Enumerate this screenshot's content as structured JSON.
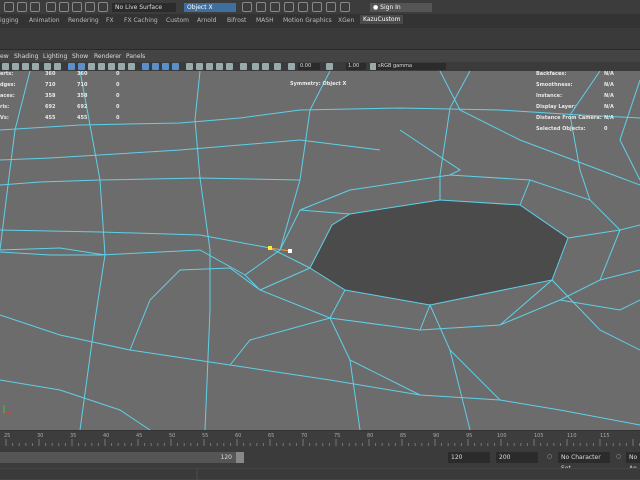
{
  "topbar": {
    "live_surface": "No Live Surface",
    "symmetry_field": "Object X",
    "signin": "Sign In"
  },
  "shelf_tabs": [
    "igging",
    "Animation",
    "Rendering",
    "FX",
    "FX Caching",
    "Custom",
    "Arnold",
    "Bifrost",
    "MASH",
    "Motion Graphics",
    "XGen",
    "KazuCustom"
  ],
  "panel_menu": [
    "ew",
    "Shading",
    "Lighting",
    "Show",
    "Renderer",
    "Panels"
  ],
  "panel_tools": {
    "value1": "0.00",
    "value2": "1.00",
    "colorspace": "sRGB gamma"
  },
  "hud": {
    "left_labels": [
      "erts:",
      "dges:",
      "aces:",
      "ris:",
      "Vs:"
    ],
    "left_col1": [
      "360",
      "710",
      "358",
      "692",
      "455"
    ],
    "left_col2": [
      "360",
      "710",
      "358",
      "692",
      "455"
    ],
    "left_col3": [
      "0",
      "0",
      "0",
      "0",
      "0"
    ],
    "symmetry": "Symmetry: Object X",
    "right_labels": [
      "Backfaces:",
      "Smoothness:",
      "Instance:",
      "Display Layer:",
      "Distance From Camera:",
      "Selected Objects:"
    ],
    "right_values": [
      "N/A",
      "N/A",
      "N/A",
      "N/A",
      "N/A",
      "0"
    ]
  },
  "timeline": {
    "ticks": [
      "25",
      "30",
      "35",
      "40",
      "45",
      "50",
      "55",
      "60",
      "65",
      "70",
      "75",
      "80",
      "85",
      "90",
      "95",
      "100",
      "105",
      "110",
      "115"
    ]
  },
  "range": {
    "current_end": "120",
    "end_field": "120",
    "max_field": "200",
    "character_set": "No Character Set",
    "anim_layer": "No An"
  },
  "colors": {
    "wire": "#5fd0e8",
    "mesh": "#6b6b6b",
    "hole": "#4d4d4d"
  }
}
